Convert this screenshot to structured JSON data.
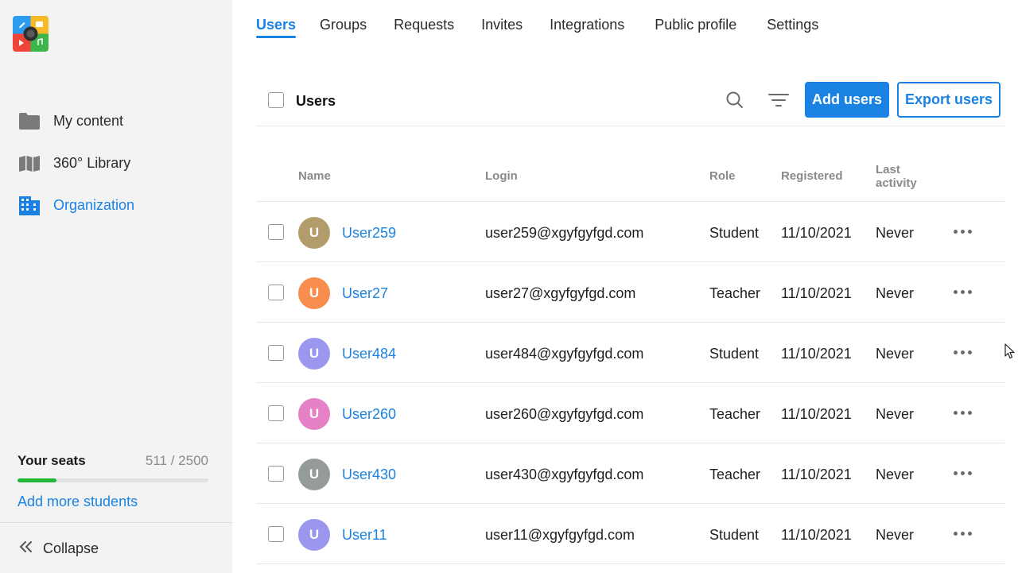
{
  "sidebar": {
    "nav": [
      {
        "label": "My content",
        "icon": "folder-icon",
        "active": false
      },
      {
        "label": "360° Library",
        "icon": "map-icon",
        "active": false
      },
      {
        "label": "Organization",
        "icon": "building-icon",
        "active": true
      }
    ],
    "seats": {
      "title": "Your seats",
      "count": "511 / 2500",
      "used_fraction": 0.2044
    },
    "add_more_label": "Add more students",
    "collapse_label": "Collapse"
  },
  "tabs": [
    {
      "label": "Users",
      "active": true
    },
    {
      "label": "Groups",
      "active": false
    },
    {
      "label": "Requests",
      "active": false
    },
    {
      "label": "Invites",
      "active": false
    },
    {
      "label": "Integrations",
      "active": false
    },
    {
      "label": "Public profile",
      "active": false
    },
    {
      "label": "Settings",
      "active": false
    }
  ],
  "toolbar": {
    "title": "Users",
    "add_label": "Add users",
    "export_label": "Export users"
  },
  "table": {
    "headers": {
      "name": "Name",
      "login": "Login",
      "role": "Role",
      "registered": "Registered",
      "last_activity_1": "Last",
      "last_activity_2": "activity"
    },
    "rows": [
      {
        "initial": "U",
        "name": "User259",
        "login": "user259@xgyfgyfgd.com",
        "role": "Student",
        "registered": "11/10/2021",
        "last_activity": "Never",
        "color": "#b39c6b"
      },
      {
        "initial": "U",
        "name": "User27",
        "login": "user27@xgyfgyfgd.com",
        "role": "Teacher",
        "registered": "11/10/2021",
        "last_activity": "Never",
        "color": "#f98d4e"
      },
      {
        "initial": "U",
        "name": "User484",
        "login": "user484@xgyfgyfgd.com",
        "role": "Student",
        "registered": "11/10/2021",
        "last_activity": "Never",
        "color": "#9b97ef"
      },
      {
        "initial": "U",
        "name": "User260",
        "login": "user260@xgyfgyfgd.com",
        "role": "Teacher",
        "registered": "11/10/2021",
        "last_activity": "Never",
        "color": "#e681c6"
      },
      {
        "initial": "U",
        "name": "User430",
        "login": "user430@xgyfgyfgd.com",
        "role": "Teacher",
        "registered": "11/10/2021",
        "last_activity": "Never",
        "color": "#959a9a"
      },
      {
        "initial": "U",
        "name": "User11",
        "login": "user11@xgyfgyfgd.com",
        "role": "Student",
        "registered": "11/10/2021",
        "last_activity": "Never",
        "color": "#9b97ef"
      }
    ]
  },
  "colors": {
    "accent": "#1a82e2",
    "seats_fill": "#20b834",
    "sidebar_bg": "#f3f3f3"
  }
}
